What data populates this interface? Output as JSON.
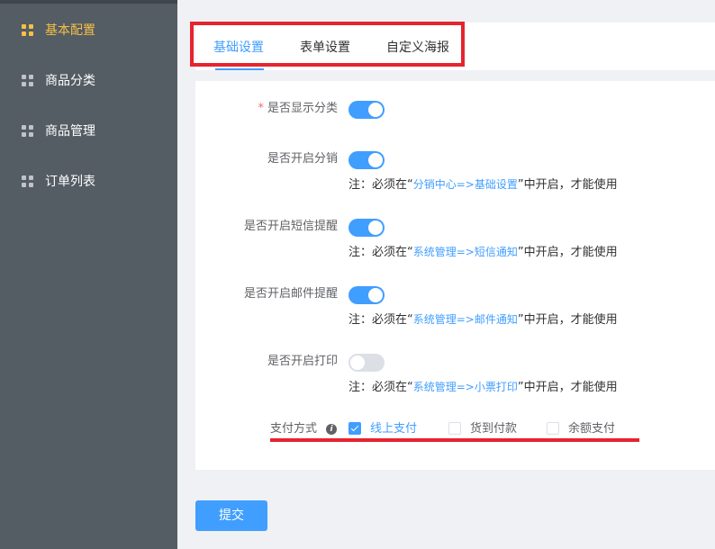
{
  "sidebar": {
    "items": [
      {
        "label": "基本配置",
        "active": true
      },
      {
        "label": "商品分类",
        "active": false
      },
      {
        "label": "商品管理",
        "active": false
      },
      {
        "label": "订单列表",
        "active": false
      }
    ]
  },
  "tabs": [
    {
      "label": "基础设置",
      "active": true
    },
    {
      "label": "表单设置",
      "active": false
    },
    {
      "label": "自定义海报",
      "active": false
    }
  ],
  "form": {
    "show_category": {
      "label": "是否显示分类",
      "required_mark": "*",
      "enabled": true
    },
    "distribution": {
      "label": "是否开启分销",
      "enabled": true,
      "note_prefix": "注：必须在“",
      "note_link": "分销中心=>基础设置",
      "note_suffix": "”中开启，才能使用"
    },
    "sms": {
      "label": "是否开启短信提醒",
      "enabled": true,
      "note_prefix": "注：必须在“",
      "note_link": "系统管理=>短信通知",
      "note_suffix": "”中开启，才能使用"
    },
    "email": {
      "label": "是否开启邮件提醒",
      "enabled": true,
      "note_prefix": "注：必须在“",
      "note_link": "系统管理=>邮件通知",
      "note_suffix": "”中开启，才能使用"
    },
    "print": {
      "label": "是否开启打印",
      "enabled": false,
      "note_prefix": "注：必须在“",
      "note_link": "系统管理=>小票打印",
      "note_suffix": "”中开启，才能使用"
    },
    "payment": {
      "label": "支付方式",
      "info_icon": "info-icon",
      "options": [
        {
          "label": "线上支付",
          "checked": true
        },
        {
          "label": "货到付款",
          "checked": false
        },
        {
          "label": "余额支付",
          "checked": false
        }
      ]
    }
  },
  "submit_label": "提交",
  "colors": {
    "sidebar_bg": "#545c64",
    "sidebar_active": "#f5c044",
    "primary": "#409eff",
    "highlight_red": "#e5242f",
    "page_bg": "#f0f1f5"
  }
}
